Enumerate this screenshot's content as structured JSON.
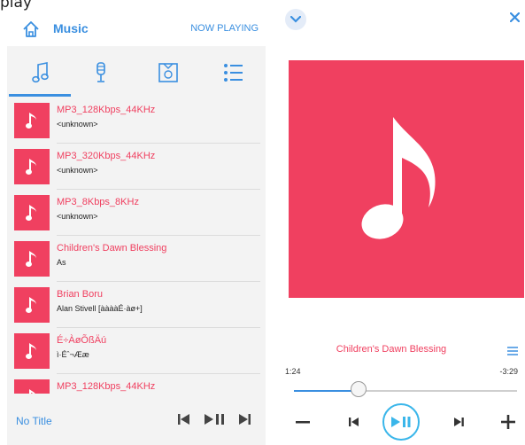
{
  "top_text": "play",
  "left": {
    "header": {
      "title": "Music",
      "now_playing": "NOW PLAYING"
    },
    "tabs": [
      {
        "icon": "music-note-icon"
      },
      {
        "icon": "microphone-icon"
      },
      {
        "icon": "album-icon"
      },
      {
        "icon": "list-icon"
      }
    ],
    "songs": [
      {
        "title": "MP3_128Kbps_44KHz",
        "artist": "<unknown>"
      },
      {
        "title": "MP3_320Kbps_44KHz",
        "artist": "<unknown>"
      },
      {
        "title": "MP3_8Kbps_8KHz",
        "artist": "<unknown>"
      },
      {
        "title": "Children's Dawn Blessing",
        "artist": "As"
      },
      {
        "title": "Brian Boru",
        "artist": "Alan Stivell [ààààÉ·àø+]"
      },
      {
        "title": "É÷ÀøÕßÄú",
        "artist": "ì·Éˆ¬Ææ"
      },
      {
        "title": "MP3_128Kbps_44KHz",
        "artist": ""
      }
    ],
    "bottom": {
      "no_title": "No Title"
    }
  },
  "right": {
    "now_playing_title": "Children's Dawn Blessing",
    "elapsed": "1:24",
    "remaining": "-3:29",
    "progress": 0.29,
    "colors": {
      "accent": "#3a8fe0",
      "pink": "#f04060",
      "play_ring": "#3ab6ea"
    }
  }
}
